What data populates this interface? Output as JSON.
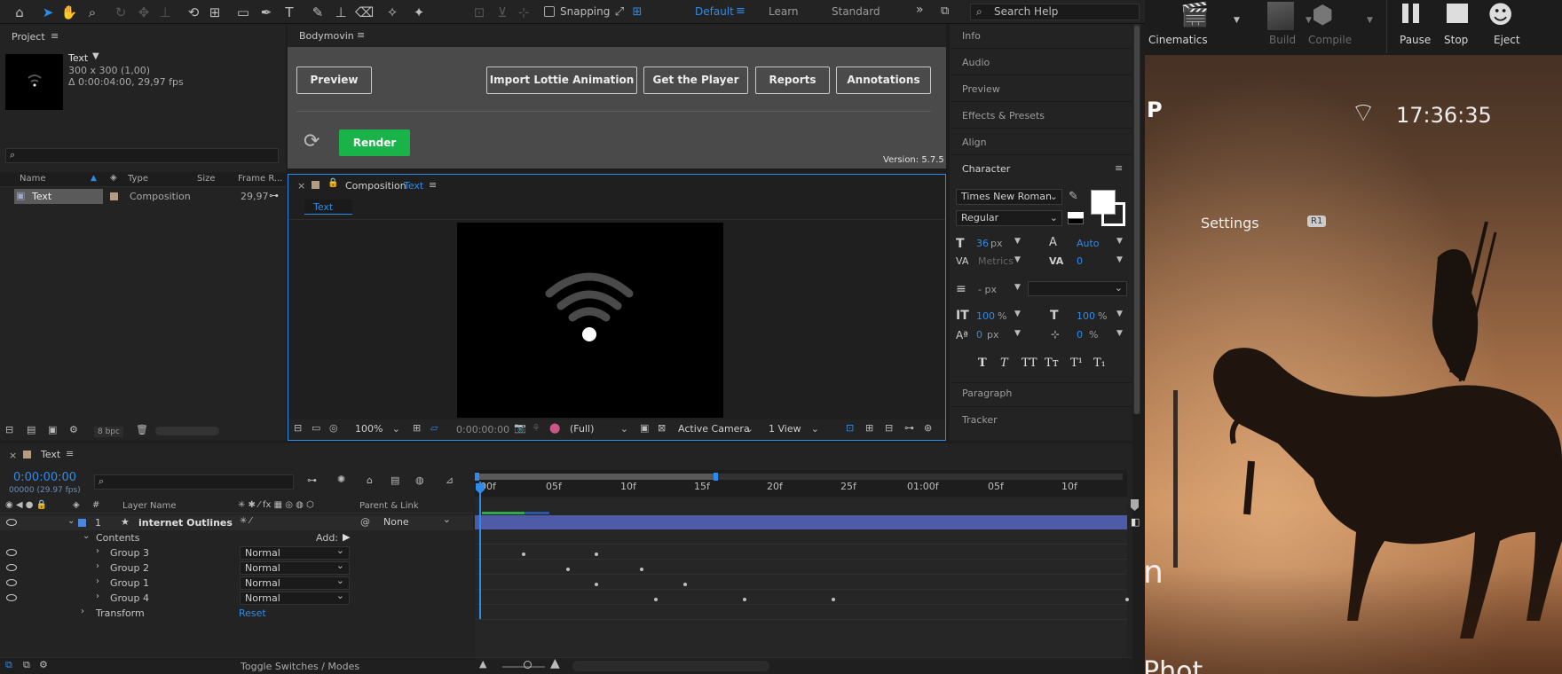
{
  "toolbar": {
    "snapping_label": "Snapping",
    "workspaces": [
      "Default",
      "Learn",
      "Standard"
    ],
    "active_workspace": "Default",
    "search_placeholder": "Search Help"
  },
  "project": {
    "panel_title": "Project",
    "item_name": "Text",
    "item_dims": "300 x 300 (1,00)",
    "item_duration": "Δ 0:00:04:00, 29,97 fps",
    "columns": [
      "Name",
      "Type",
      "Size",
      "Frame R..."
    ],
    "rows": [
      {
        "name": "Text",
        "type": "Composition",
        "size": "",
        "frame_rate": "29,97"
      }
    ],
    "bpc": "8 bpc"
  },
  "bodymovin": {
    "title": "Bodymovin",
    "buttons": [
      "Preview",
      "Import Lottie Animation",
      "Get the Player",
      "Reports",
      "Annotations"
    ],
    "render_label": "Render",
    "version": "Version: 5.7.5"
  },
  "composition": {
    "header_prefix": "Composition",
    "name": "Text",
    "tab": "Text",
    "zoom": "100%",
    "timecode": "0:00:00:00",
    "resolution": "(Full)",
    "camera": "Active Camera",
    "views": "1 View"
  },
  "right_panels": {
    "items": [
      "Info",
      "Audio",
      "Preview",
      "Effects & Presets",
      "Align"
    ],
    "character_title": "Character",
    "font_family": "Times New Roman",
    "font_style": "Regular",
    "font_size": "36",
    "font_size_unit": "px",
    "leading": "Auto",
    "kerning": "Metrics",
    "tracking": "0",
    "stroke_unit": "- px",
    "vscale": "100",
    "hscale": "100",
    "baseline": "0",
    "baseline_unit": "px",
    "tsume": "0",
    "pct": "%",
    "after_items": [
      "Paragraph",
      "Tracker"
    ]
  },
  "unreal": {
    "buttons": [
      {
        "label": "Cinematics",
        "enabled": true
      },
      {
        "label": "Build",
        "enabled": false
      },
      {
        "label": "Compile",
        "enabled": false
      },
      {
        "label": "Pause",
        "enabled": true
      },
      {
        "label": "Stop",
        "enabled": true
      },
      {
        "label": "Eject",
        "enabled": true
      }
    ],
    "clock": "17:36:35",
    "settings_label": "Settings",
    "r1_label": "R1",
    "partial_letter_top": "P",
    "partial_letter_mid": "n",
    "partial_bottom": "Phot"
  },
  "timeline": {
    "tab": "Text",
    "timecode": "0:00:00:00",
    "frames": "00000 (29.97 fps)",
    "columns": {
      "layer_name": "Layer Name",
      "parent": "Parent & Link"
    },
    "ruler_ticks": [
      "00f",
      "05f",
      "10f",
      "15f",
      "20f",
      "25f",
      "01:00f",
      "05f",
      "10f"
    ],
    "layer": {
      "index": "1",
      "name": "internet Outlines",
      "parent": "None"
    },
    "contents_label": "Contents",
    "add_label": "Add:",
    "groups": [
      {
        "name": "Group 3",
        "blend": "Normal"
      },
      {
        "name": "Group 2",
        "blend": "Normal"
      },
      {
        "name": "Group 1",
        "blend": "Normal"
      },
      {
        "name": "Group 4",
        "blend": "Normal"
      }
    ],
    "transform_label": "Transform",
    "reset_label": "Reset",
    "toggle_label": "Toggle Switches / Modes"
  },
  "colors": {
    "accent": "#2d8ceb",
    "render_green": "#1ab34a",
    "layer_bar": "#4d5ba8"
  }
}
